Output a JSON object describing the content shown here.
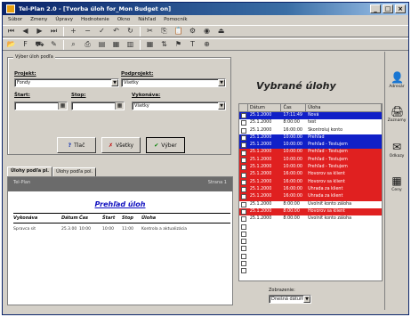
{
  "window": {
    "title": "Tel-Plan 2.0 - [Tvorba úloh for_Mon Budget on]"
  },
  "menu": [
    "Súbor",
    "Zmeny",
    "Úpravy",
    "Hodnotenie",
    "Okno",
    "Náhľad",
    "Pomocník"
  ],
  "filter": {
    "legend": "Výber úloh podľa",
    "project_label": "Projekt:",
    "project_value": "Fondy",
    "subcontractor_label": "Podprojekt:",
    "subcontractor_value": "Všetky",
    "start_label": "Štart:",
    "stop_label": "Stop:",
    "responsible_label": "Vykonáva:",
    "responsible_value": "Všetky"
  },
  "buttons": {
    "print": "Tlač",
    "all": "Všetky",
    "select": "Výber"
  },
  "tabs": [
    "Úlohy podľa pl.",
    "Úlohy podľa pol."
  ],
  "preview": {
    "header_left": "Tel-Plan",
    "header_right": "Strana 1",
    "title": "Prehľad úloh",
    "columns": [
      "Vykonáva",
      "Dátum",
      "Čas",
      "Štart",
      "Stop",
      "Úloha"
    ],
    "row": [
      "Spravca sit",
      "25.3.00",
      "10:00",
      "10:00",
      "11:00",
      "Kontrola a aktualizácia"
    ]
  },
  "right": {
    "title": "Vybrané úlohy",
    "columns": [
      "Dátum",
      "Čas",
      "Úloha"
    ],
    "rows": [
      {
        "date": "25.1.2000",
        "time": "17:11:49",
        "task": "Nová",
        "style": "blue"
      },
      {
        "date": "25.1.2000",
        "time": "8:00:00",
        "task": "test",
        "style": "none"
      },
      {
        "date": "25.1.2000",
        "time": "16:00:00",
        "task": "Skontroluj konto",
        "style": "none"
      },
      {
        "date": "25.1.2000",
        "time": "10:00:00",
        "task": "Prehľad",
        "style": "blue"
      },
      {
        "date": "25.1.2000",
        "time": "10:00:00",
        "task": "Prehľad - Testujem",
        "style": "sel"
      },
      {
        "date": "25.1.2000",
        "time": "10:00:00",
        "task": "Prehľad - Testujem",
        "style": "red"
      },
      {
        "date": "25.1.2000",
        "time": "10:00:00",
        "task": "Prehľad - Testujem",
        "style": "red"
      },
      {
        "date": "25.1.2000",
        "time": "10:00:00",
        "task": "Prehľad - Testujem",
        "style": "red"
      },
      {
        "date": "25.1.2000",
        "time": "16:00:00",
        "task": "Hovorov sa klient",
        "style": "red"
      },
      {
        "date": "25.1.2000",
        "time": "16:00:00",
        "task": "Hovorov sa klient",
        "style": "red"
      },
      {
        "date": "25.1.2000",
        "time": "16:00:00",
        "task": "Uhrada za klient",
        "style": "red"
      },
      {
        "date": "25.1.2000",
        "time": "16:00:00",
        "task": "Uhrada za klient",
        "style": "red"
      },
      {
        "date": "25.1.2000",
        "time": "8:00:00",
        "task": "Uvolniť konto záloha",
        "style": "none"
      },
      {
        "date": "25.1.2000",
        "time": "8:00:00",
        "task": "Hovorov sa klient",
        "style": "red"
      },
      {
        "date": "25.1.2000",
        "time": "8:00:00",
        "task": "Uvolniť konto záloha",
        "style": "none"
      },
      {
        "date": "",
        "time": "",
        "task": "",
        "style": "none"
      },
      {
        "date": "",
        "time": "",
        "task": "",
        "style": "none"
      },
      {
        "date": "",
        "time": "",
        "task": "",
        "style": "none"
      },
      {
        "date": "",
        "time": "",
        "task": "",
        "style": "none"
      },
      {
        "date": "",
        "time": "",
        "task": "",
        "style": "none"
      },
      {
        "date": "",
        "time": "",
        "task": "",
        "style": "none"
      },
      {
        "date": "",
        "time": "",
        "task": "",
        "style": "none"
      }
    ],
    "zoom_label": "Zobrazenie:",
    "zoom_value": "Dnešná dátum"
  },
  "sidebar": [
    {
      "label": "Adresár",
      "icon": "address-book-icon",
      "glyph": "👤"
    },
    {
      "label": "Zoznamy",
      "icon": "lists-icon",
      "glyph": "🖨"
    },
    {
      "label": "Odkazy",
      "icon": "messages-icon",
      "glyph": "✉"
    },
    {
      "label": "Ceny",
      "icon": "calendar-icon",
      "glyph": "▦"
    }
  ]
}
